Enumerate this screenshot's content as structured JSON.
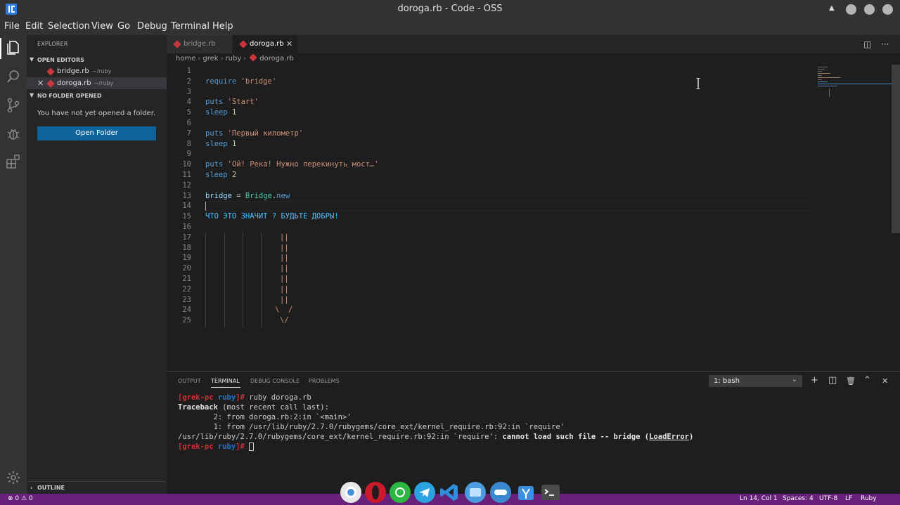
{
  "window": {
    "title": "doroga.rb - Code - OSS"
  },
  "menu": [
    "File",
    "Edit",
    "Selection",
    "View",
    "Go",
    "Debug",
    "Terminal",
    "Help"
  ],
  "activity_bar": {
    "items": [
      "explorer-icon",
      "search-icon",
      "source-control-icon",
      "debug-icon",
      "extensions-icon"
    ],
    "bottom": "settings-gear-icon"
  },
  "sidebar": {
    "title": "EXPLORER",
    "open_editors_label": "OPEN EDITORS",
    "open_editors": [
      {
        "name": "bridge.rb",
        "dir": "~/ruby"
      },
      {
        "name": "doroga.rb",
        "dir": "~/ruby"
      }
    ],
    "no_folder_label": "NO FOLDER OPENED",
    "no_folder_message": "You have not yet opened a folder.",
    "open_folder_button": "Open Folder",
    "outline_label": "OUTLINE"
  },
  "tabs": [
    {
      "label": "bridge.rb",
      "active": false
    },
    {
      "label": "doroga.rb",
      "active": true
    }
  ],
  "breadcrumb": [
    "home",
    "grek",
    "ruby",
    "doroga.rb"
  ],
  "editor": {
    "line_numbers": [
      "1",
      "2",
      "3",
      "4",
      "5",
      "6",
      "7",
      "8",
      "9",
      "10",
      "11",
      "12",
      "13",
      "14",
      "15",
      "16",
      "17",
      "18",
      "19",
      "20",
      "21",
      "22",
      "23",
      "24",
      "25"
    ],
    "lines": {
      "l2_kw": "require",
      "l2_str": "'bridge'",
      "l4_kw": "puts",
      "l4_str": "'Start'",
      "l5_kw": "sleep",
      "l5_num": "1",
      "l7_kw": "puts",
      "l7_str": "'Первый километр'",
      "l8_kw": "sleep",
      "l8_num": "1",
      "l10_kw": "puts",
      "l10_str": "'Ой! Река! Нужно перекинуть мост…'",
      "l11_kw": "sleep",
      "l11_num": "2",
      "l13_var": "bridge",
      "l13_op": " = ",
      "l13_cls": "Bridge",
      "l13_dot": ".",
      "l13_meth": "new",
      "l15_const": "ЧТО ЭТО ЗНАЧИТ ? БУДЬТЕ ДОБРЫ!",
      "l17": "||",
      "l18": "||",
      "l19": "||",
      "l20": "||",
      "l21": "||",
      "l22": "||",
      "l23": "||",
      "l24": "\\  /",
      "l25": "\\/"
    }
  },
  "panel": {
    "tabs": [
      "OUTPUT",
      "TERMINAL",
      "DEBUG CONSOLE",
      "PROBLEMS"
    ],
    "active_tab": "TERMINAL",
    "terminal_select": "1: bash",
    "terminal": {
      "prompt_user": "[grek-pc",
      "prompt_dir": "ruby",
      "prompt_end": "]#",
      "cmd": " ruby doroga.rb",
      "tb_bold": "Traceback",
      "tb_rest": " (most recent call last):",
      "tb2": "        2: from doroga.rb:2:in `<main>'",
      "tb1": "        1: from /usr/lib/ruby/2.7.0/rubygems/core_ext/kernel_require.rb:92:in `require'",
      "err_path": "/usr/lib/ruby/2.7.0/rubygems/core_ext/kernel_require.rb:92:in `require': ",
      "err_msg": "cannot load such file -- bridge (",
      "err_class": "LoadError",
      "err_close": ")"
    }
  },
  "statusbar": {
    "errors": "0",
    "warnings": "0",
    "position": "Ln 14, Col 1",
    "spaces": "Spaces: 4",
    "encoding": "UTF-8",
    "eol": "LF",
    "language": "Ruby"
  },
  "dock": [
    "chromium-icon",
    "opera-icon",
    "whatsapp-icon",
    "telegram-icon",
    "vscode-icon",
    "files-icon",
    "settings-toggle-icon",
    "store-icon",
    "terminal-icon"
  ],
  "colors": {
    "accent": "#0e639c",
    "statusbar": "#68217a",
    "ruby": "#c8373d"
  }
}
